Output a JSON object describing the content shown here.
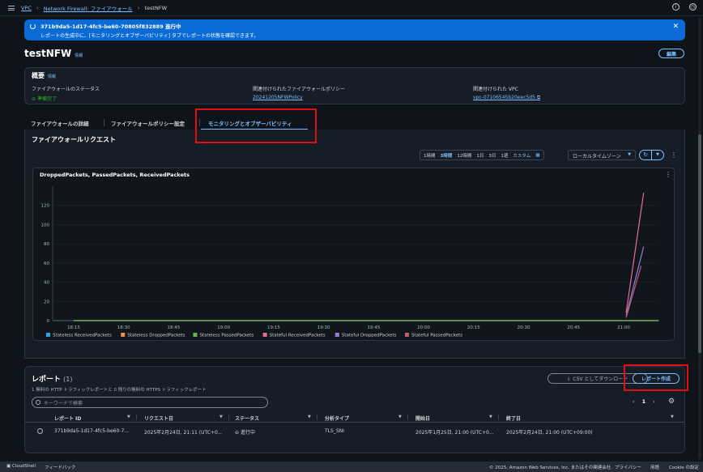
{
  "breadcrumb": {
    "items": [
      "VPC",
      "Network Firewall: ファイアウォール"
    ],
    "current": "testNFW"
  },
  "flash": {
    "title": "371b9da5-1d17-4fc5-be60-70805f832889 進行中",
    "message": "レポートの生成中に、[モニタリングとオブザーバビリティ] タブでレポートの状態を確認できます。"
  },
  "page": {
    "title": "testNFW",
    "info": "情報",
    "edit_label": "編集"
  },
  "summary": {
    "title": "概要",
    "info": "情報",
    "status_label": "ファイアウォールのステータス",
    "status_value": "準備完了",
    "policy_label": "関連付けられたファイアウォールポリシー",
    "policy_value": "20241205NFWPolicy",
    "vpc_label": "関連付けられた VPC",
    "vpc_value": "vpc-07106545b20eec5d5"
  },
  "tabs": [
    {
      "label": "ファイアウォールの詳細"
    },
    {
      "label": "ファイアウォールポリシー設定"
    },
    {
      "label": "モニタリングとオブザーバビリティ"
    }
  ],
  "monitoring": {
    "title": "ファイアウォールリクエスト",
    "time_options": [
      "1時間",
      "3時間",
      "12時間",
      "1日",
      "3日",
      "1週",
      "カスタム"
    ],
    "selected_time": "3時間",
    "timezone": "ローカルタイムゾーン"
  },
  "chart_data": {
    "type": "line",
    "title": "DroppedPackets, PassedPackets, ReceivedPackets",
    "x": [
      "18:15",
      "18:30",
      "18:45",
      "19:00",
      "19:15",
      "19:30",
      "19:45",
      "20:00",
      "20:15",
      "20:30",
      "20:45",
      "21:00"
    ],
    "ylim": [
      0,
      140
    ],
    "yticks": [
      0,
      20,
      40,
      60,
      80,
      100,
      120
    ],
    "series": [
      {
        "name": "Stateless ReceivedPackets",
        "color": "#2ea8e0",
        "points": [
          [
            0,
            0
          ],
          [
            11.7,
            0
          ]
        ]
      },
      {
        "name": "Stateless DroppedPackets",
        "color": "#f08a4b",
        "points": [
          [
            0,
            0
          ],
          [
            11.7,
            0
          ]
        ]
      },
      {
        "name": "Stateless PassedPackets",
        "color": "#6ab04c",
        "points": [
          [
            0,
            0
          ],
          [
            11.7,
            0
          ]
        ]
      },
      {
        "name": "Stateful ReceivedPackets",
        "color": "#e86b91",
        "points": [
          [
            11.05,
            8
          ],
          [
            11.4,
            133
          ]
        ]
      },
      {
        "name": "Stateful DroppedPackets",
        "color": "#9b7bd8",
        "points": [
          [
            11.05,
            5
          ],
          [
            11.4,
            77
          ]
        ]
      },
      {
        "name": "Stateful PassedPackets",
        "color": "#c15b6a",
        "points": [
          [
            11.05,
            3
          ],
          [
            11.35,
            57
          ]
        ]
      }
    ]
  },
  "reports": {
    "title": "レポート",
    "count": "(1)",
    "description": "1 無料の HTTP トラフィックレポートと 0 残りの無料の HTTPS トラフィックレポート",
    "csv_label": "CSV としてダウンロード",
    "create_label": "レポート作成",
    "search_placeholder": "キーワードで検索",
    "page": "1",
    "columns": [
      "レポート ID",
      "リクエスト日",
      "ステータス",
      "分析タイプ",
      "開始日",
      "終了日"
    ],
    "rows": [
      {
        "id": "371b9da5-1d17-4fc5-be60-7...",
        "requested": "2025年2月24日, 21:11 (UTC+0...",
        "status": "進行中",
        "type": "TLS_SNI",
        "start": "2025年1月25日, 21:00 (UTC+0...",
        "end": "2025年2月24日, 21:00 (UTC+09:00)"
      }
    ]
  },
  "footer": {
    "cloudshell": "CloudShell",
    "feedback": "フィードバック",
    "copyright": "© 2025, Amazon Web Services, Inc. またはその関連会社.",
    "privacy": "プライバシー",
    "terms": "用語",
    "cookie": "Cookie の設定"
  }
}
